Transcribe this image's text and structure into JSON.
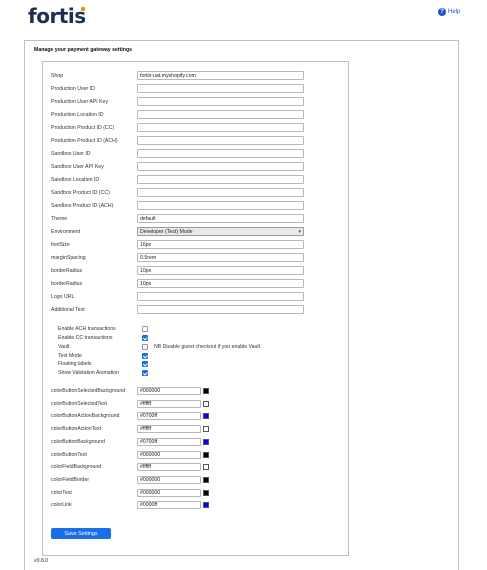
{
  "brand": {
    "logo": "fortis"
  },
  "header": {
    "help_label": "Help",
    "help_icon": "question-circle-icon"
  },
  "page": {
    "title": "Manage your payment gateway settings",
    "version": "v0.8.0"
  },
  "fields": [
    {
      "label": "Shop",
      "value": "fortis-uat.myshopify.com"
    },
    {
      "label": "Production User ID",
      "value": ""
    },
    {
      "label": "Production User API Key",
      "value": ""
    },
    {
      "label": "Production Location ID",
      "value": ""
    },
    {
      "label": "Production Product ID (CC)",
      "value": ""
    },
    {
      "label": "Production Product ID (ACH)",
      "value": ""
    },
    {
      "label": "Sandbox User ID",
      "value": ""
    },
    {
      "label": "Sandbox User API Key",
      "value": ""
    },
    {
      "label": "Sandbox Location ID",
      "value": ""
    },
    {
      "label": "Sandbox Product ID (CC)",
      "value": ""
    },
    {
      "label": "Sandbox Product ID (ACH)",
      "value": ""
    },
    {
      "label": "Theme",
      "value": "default"
    },
    {
      "label": "Environment",
      "value": "Developer (Test) Mode",
      "type": "select"
    },
    {
      "label": "fontSize",
      "value": "16px"
    },
    {
      "label": "marginSpacing",
      "value": "0.5rem"
    },
    {
      "label": "borderRadius",
      "value": "10px"
    },
    {
      "label": "borderRadius",
      "value": "10px"
    },
    {
      "label": "Logo URL",
      "value": ""
    },
    {
      "label": "Additional Text",
      "value": ""
    }
  ],
  "checkboxes": [
    {
      "label": "Enable ACH transactions",
      "checked": false
    },
    {
      "label": "Enable CC transactions",
      "checked": true
    },
    {
      "label": "Vault",
      "checked": false,
      "note": "NB Disable guest checkout if you enable Vault"
    },
    {
      "label": "Test Mode",
      "checked": true
    },
    {
      "label": "Floating labels",
      "checked": true
    },
    {
      "label": "Show Validation Animation",
      "checked": true
    }
  ],
  "colors": [
    {
      "label": "colorButtonSelectedBackground",
      "value": "#000000",
      "swatch": "#000000"
    },
    {
      "label": "colorButtonSelectedText",
      "value": "#ffffff",
      "swatch": "#ffffff"
    },
    {
      "label": "colorButtonActionBackground",
      "value": "#0700ff",
      "swatch": "#0700ff"
    },
    {
      "label": "colorButtonActionText",
      "value": "#ffffff",
      "swatch": "#ffffff"
    },
    {
      "label": "colorButtonBackground",
      "value": "#0700ff",
      "swatch": "#0700ff"
    },
    {
      "label": "colorButtonText",
      "value": "#000000",
      "swatch": "#000000"
    },
    {
      "label": "colorFieldBackground",
      "value": "#ffffff",
      "swatch": "#ffffff"
    },
    {
      "label": "colorFieldBorder",
      "value": "#000000",
      "swatch": "#000000"
    },
    {
      "label": "colorText",
      "value": "#000000",
      "swatch": "#000000"
    },
    {
      "label": "colorLink",
      "value": "#0000ff",
      "swatch": "#0000ff"
    }
  ],
  "actions": {
    "save_label": "Save Settings"
  },
  "theme_colors": {
    "accent": "#1a6fe8",
    "brand_navy": "#1c2f4e",
    "brand_orange": "#f28c1b"
  }
}
